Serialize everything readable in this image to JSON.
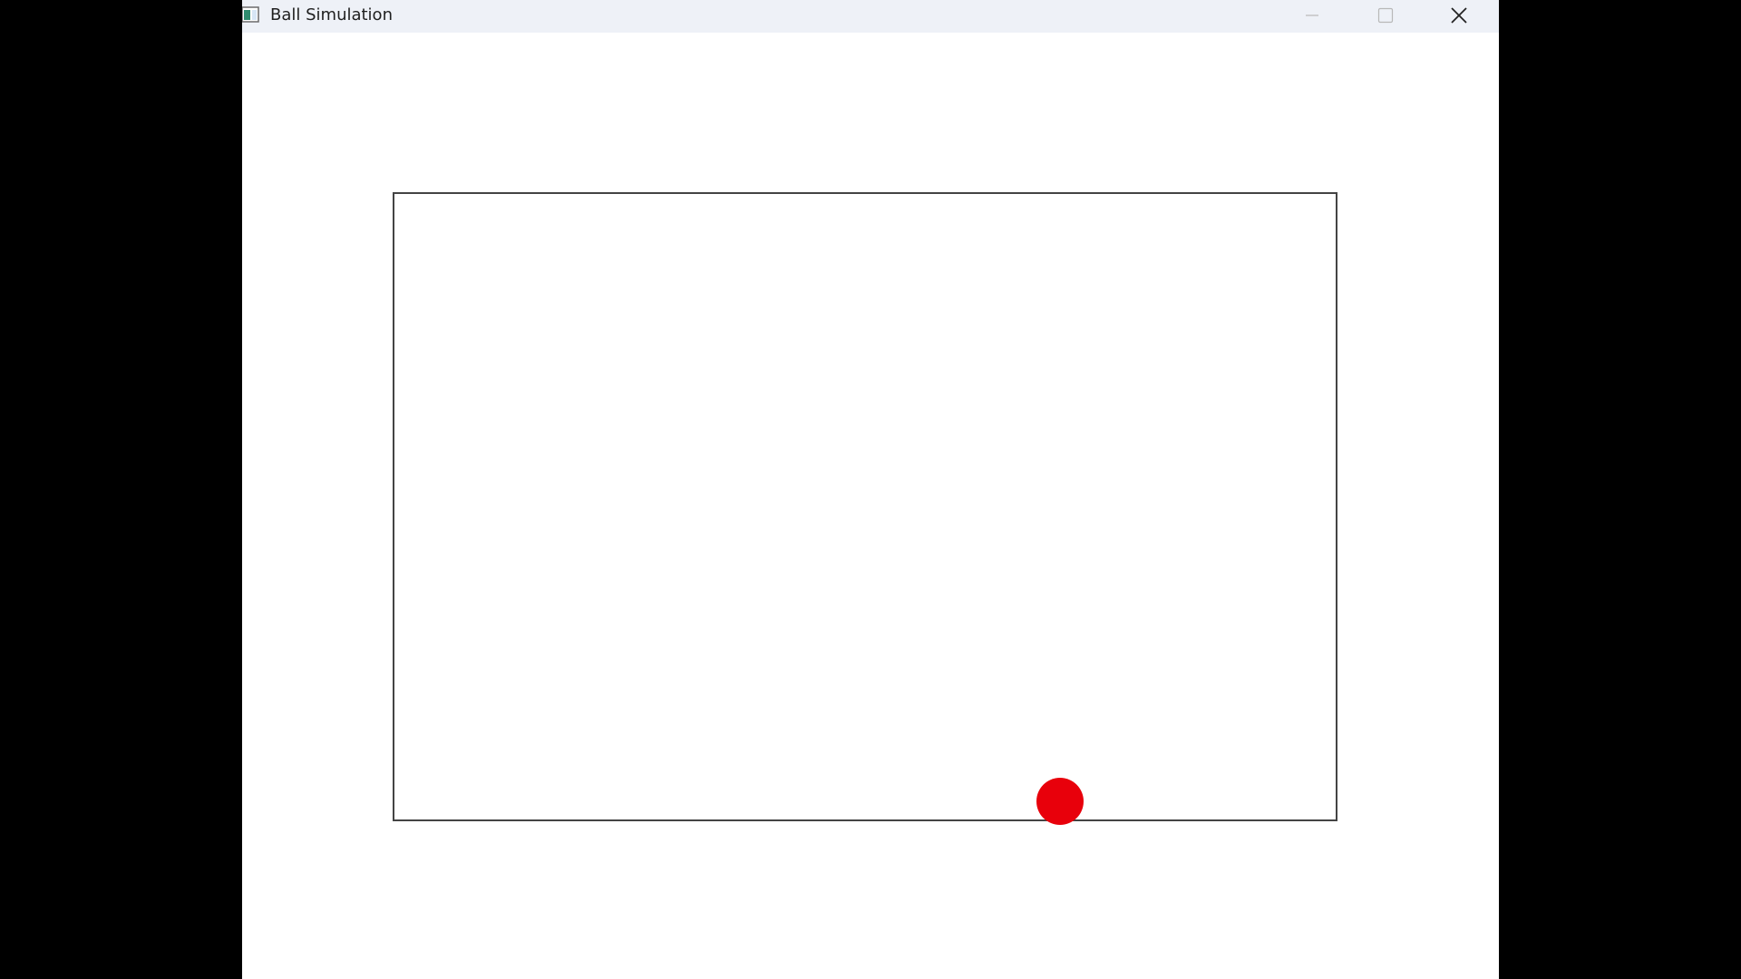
{
  "window": {
    "title": "Ball Simulation",
    "icon": "app-icon"
  },
  "title_controls": {
    "minimize": "minimize-icon",
    "maximize": "maximize-icon",
    "close": "close-icon"
  },
  "simulation": {
    "ball": {
      "color": "#e8000b"
    },
    "border_color": "#444444"
  }
}
